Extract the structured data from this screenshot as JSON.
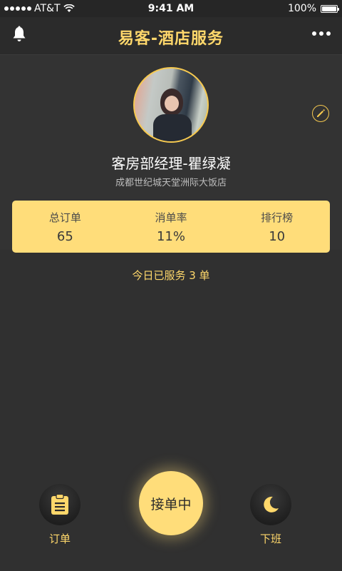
{
  "status_bar": {
    "carrier": "AT&T",
    "time": "9:41 AM",
    "battery": "100%"
  },
  "nav": {
    "title": "易客-酒店服务",
    "left_icon": "bell-icon",
    "right_icon": "more-icon"
  },
  "profile": {
    "name": "客房部经理-瞿绿凝",
    "hotel": "成都世纪城天堂洲际大饭店",
    "edit_icon": "pencil-icon"
  },
  "stats": [
    {
      "label": "总订单",
      "value": "65"
    },
    {
      "label": "消单率",
      "value": "11%"
    },
    {
      "label": "排行榜",
      "value": "10"
    }
  ],
  "served_today": "今日已服务 3 单",
  "bottom": {
    "orders_label": "订单",
    "orders_icon": "clipboard-icon",
    "accept_label": "接单中",
    "offwork_label": "下班",
    "offwork_icon": "moon-icon"
  },
  "colors": {
    "accent": "#ffd86b",
    "card": "#ffdd7a",
    "background": "#303030"
  }
}
